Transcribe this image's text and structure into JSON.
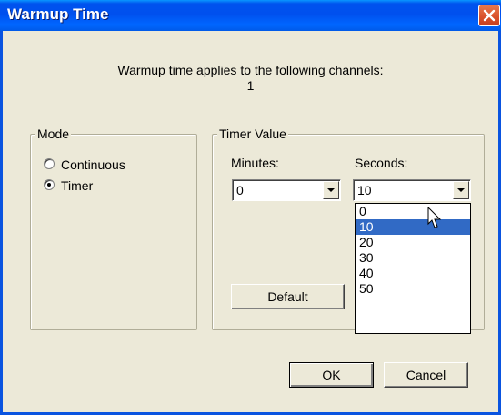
{
  "window": {
    "title": "Warmup Time"
  },
  "info": {
    "line1": "Warmup time applies to the following channels:",
    "line2": "1"
  },
  "mode": {
    "legend": "Mode",
    "options": [
      {
        "label": "Continuous",
        "selected": false
      },
      {
        "label": "Timer",
        "selected": true
      }
    ]
  },
  "timer": {
    "legend": "Timer Value",
    "minutes_label": "Minutes:",
    "minutes_value": "0",
    "seconds_label": "Seconds:",
    "seconds_value": "10",
    "seconds_options": [
      "0",
      "10",
      "20",
      "30",
      "40",
      "50"
    ],
    "seconds_highlighted": "10",
    "default_label": "Default"
  },
  "buttons": {
    "ok": "OK",
    "cancel": "Cancel"
  },
  "colors": {
    "titlebar": "#0054e3",
    "face": "#ece9d8",
    "selection": "#316ac5",
    "close": "#d9502a"
  }
}
